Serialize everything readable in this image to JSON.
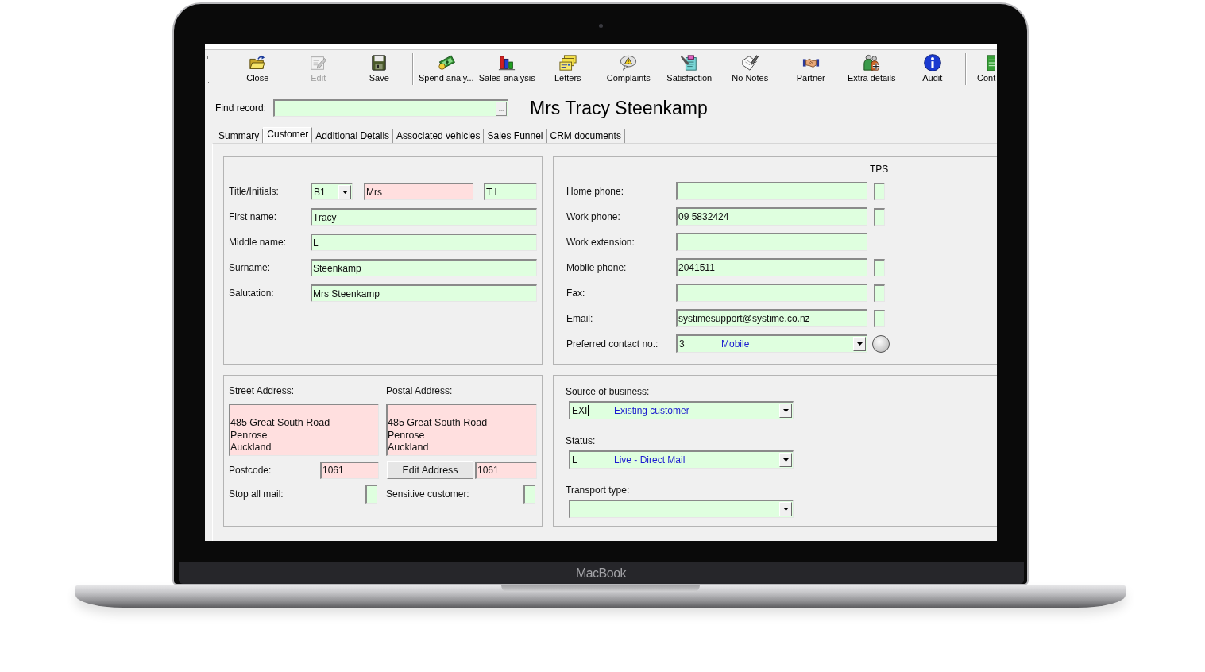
{
  "device": {
    "label": "MacBook"
  },
  "toolbar": {
    "groups": [
      [
        {
          "label": "Close",
          "disabled": false
        },
        {
          "label": "Edit",
          "disabled": true
        },
        {
          "label": "Save",
          "disabled": false
        }
      ],
      [
        {
          "label": "Spend analy...",
          "disabled": false
        },
        {
          "label": "Sales-analysis",
          "disabled": false
        },
        {
          "label": "Letters",
          "disabled": false
        },
        {
          "label": "Complaints",
          "disabled": false
        },
        {
          "label": "Satisfaction",
          "disabled": false
        },
        {
          "label": "No Notes",
          "disabled": false
        },
        {
          "label": "Partner",
          "disabled": false
        },
        {
          "label": "Extra details",
          "disabled": false
        },
        {
          "label": "Audit",
          "disabled": false
        }
      ],
      [
        {
          "label": "Cont",
          "disabled": false
        }
      ]
    ]
  },
  "find_record": {
    "label": "Find record:",
    "browse_button": "..."
  },
  "record_title": "Mrs Tracy Steenkamp",
  "tabs": [
    {
      "label": "Summary",
      "selected": false
    },
    {
      "label": "Customer",
      "selected": true
    },
    {
      "label": "Additional Details",
      "selected": false
    },
    {
      "label": "Associated vehicles",
      "selected": false
    },
    {
      "label": "Sales Funnel",
      "selected": false
    },
    {
      "label": "CRM documents",
      "selected": false
    }
  ],
  "name_panel": {
    "title_row": {
      "label": "Title/Initials:",
      "code": {
        "value": "B1",
        "color": "#dfffdf"
      },
      "title": {
        "value": "Mrs",
        "color": "#ffdfdf"
      },
      "initials": {
        "value": "T L",
        "color": "#dfffdf"
      }
    },
    "fields": [
      {
        "label": "First name:",
        "value": "Tracy",
        "color": "#dfffdf"
      },
      {
        "label": "Middle name:",
        "value": "L",
        "color": "#dfffdf"
      },
      {
        "label": "Surname:",
        "value": "Steenkamp",
        "color": "#dfffdf"
      },
      {
        "label": "Salutation:",
        "value": "Mrs Steenkamp",
        "color": "#dfffdf"
      }
    ]
  },
  "contact_panel": {
    "tps_header": "TPS",
    "rows": [
      {
        "label": "Home phone:",
        "color": "#dfffdf",
        "tps": {
          "checked": false
        }
      },
      {
        "label": "Work phone:",
        "value": "09 5832424",
        "color": "#dfffdf",
        "tps": {
          "checked": false
        }
      },
      {
        "label": "Work extension:",
        "color": "#dfffdf"
      },
      {
        "label": "Mobile phone:",
        "value": "2041511",
        "color": "#dfffdf",
        "tps": {
          "checked": false
        }
      },
      {
        "label": "Fax:",
        "color": "#dfffdf",
        "tps": {
          "checked": false
        }
      },
      {
        "label": "Email:",
        "value": "systimesupport@systime.co.nz",
        "color": "#dfffdf",
        "tps": {
          "checked": false
        }
      }
    ],
    "preferred": {
      "label": "Preferred contact no.:",
      "code": "3",
      "text": "Mobile",
      "color": "#dfffdf"
    }
  },
  "address_panel": {
    "columns": [
      {
        "label": "Street Address:",
        "lines": [
          "485 Great South Road",
          "Penrose",
          "Auckland"
        ],
        "color": "#ffdfdf",
        "postcode_label": "Postcode:",
        "postcode": {
          "value": "1061",
          "color": "#ffdfdf"
        },
        "flag": {
          "label": "Stop all mail:",
          "checked": false
        }
      },
      {
        "label": "Postal Address:",
        "lines": [
          "485 Great South Road",
          "Penrose",
          "Auckland"
        ],
        "color": "#ffdfdf",
        "button": "Edit Address",
        "postcode": {
          "value": "1061",
          "color": "#ffdfdf"
        },
        "flag": {
          "label": "Sensitive customer:",
          "checked": false
        }
      }
    ]
  },
  "business_panel": {
    "combos": [
      {
        "label": "Source of business:",
        "code": "EXI",
        "text": "Existing customer",
        "color": "#dfffdf",
        "focused": true
      },
      {
        "label": "Status:",
        "code": "L",
        "text": "Live - Direct Mail",
        "color": "#dfffdf",
        "focused": false
      },
      {
        "label": "Transport type:",
        "color": "#dfffdf",
        "focused": false
      }
    ]
  }
}
